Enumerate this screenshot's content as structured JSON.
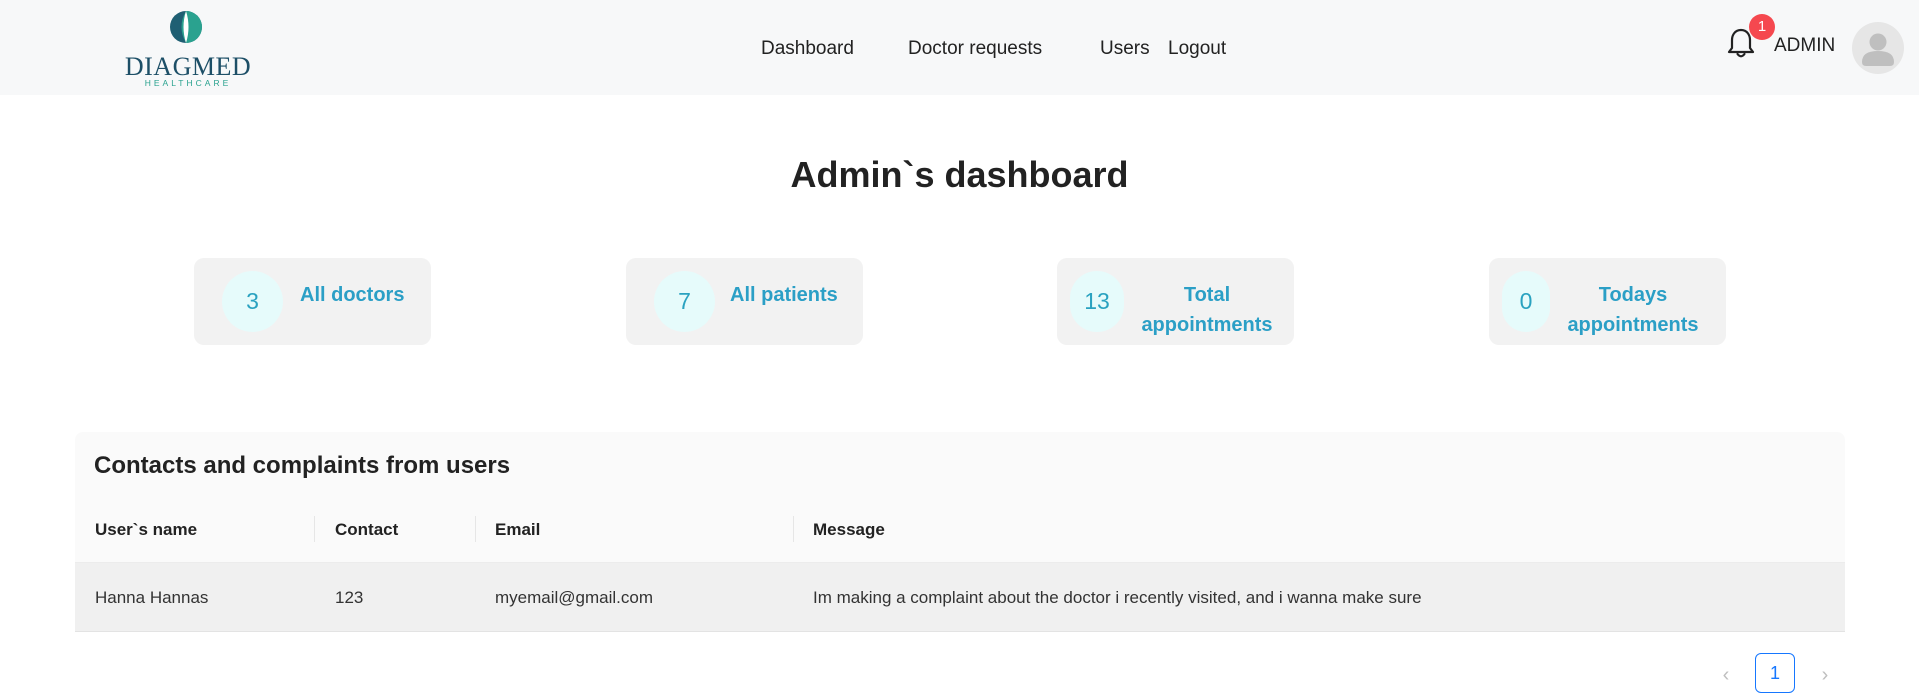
{
  "brand": {
    "name": "DIAGMED",
    "tagline": "HEALTHCARE"
  },
  "nav": {
    "dashboard": "Dashboard",
    "doctor_requests": "Doctor requests",
    "users": "Users",
    "logout": "Logout"
  },
  "header": {
    "notification_count": "1",
    "user_name": "ADMIN"
  },
  "page_title": "Admin`s dashboard",
  "stats": [
    {
      "value": "3",
      "label_line1": "All doctors",
      "label_line2": ""
    },
    {
      "value": "7",
      "label_line1": "All patients",
      "label_line2": ""
    },
    {
      "value": "13",
      "label_line1": "Total",
      "label_line2": "appointments"
    },
    {
      "value": "0",
      "label_line1": "Todays",
      "label_line2": "appointments"
    }
  ],
  "contacts": {
    "title": "Contacts and complaints from users",
    "columns": [
      "User`s name",
      "Contact",
      "Email",
      "Message"
    ],
    "rows": [
      [
        "Hanna Hannas",
        "123",
        "myemail@gmail.com",
        "Im making a complaint about the doctor i recently visited, and i wanna make sure"
      ]
    ]
  },
  "pagination": {
    "current": "1",
    "prev": "‹",
    "next": "›"
  },
  "colors": {
    "accent": "#2b9fc6",
    "badge": "#f5484f",
    "pagination_active": "#1677ff",
    "logo_text": "#1d4f67"
  }
}
